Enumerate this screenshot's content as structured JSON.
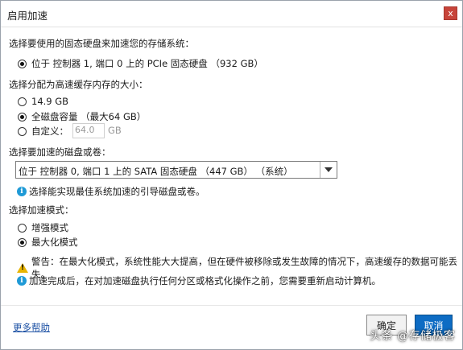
{
  "window": {
    "title": "启用加速",
    "close": "x"
  },
  "sections": {
    "storage_label": "选择要使用的固态硬盘来加速您的存储系统：",
    "storage_option": "位于 控制器 1, 端口 0 上的 PCIe 固态硬盘 （932 GB）",
    "cache_label": "选择分配为高速缓存内存的大小：",
    "cache_options": [
      "14.9 GB",
      "全磁盘容量 （最大64 GB）",
      "自定义："
    ],
    "custom_value": "64.0",
    "custom_unit": "GB",
    "disk_label": "选择要加速的磁盘或卷：",
    "disk_selected": "位于 控制器 0, 端口 1 上的 SATA 固态硬盘 （447 GB） （系统）",
    "disk_hint": "选择能实现最佳系统加速的引导磁盘或卷。",
    "mode_label": "选择加速模式：",
    "mode_options": [
      "增强模式",
      "最大化模式"
    ],
    "warning": "警告：在最大化模式，系统性能大大提高，但在硬件被移除或发生故障的情况下，高速缓存的数据可能丢失。",
    "note": "加速完成后，在对加速磁盘执行任何分区或格式化操作之前，您需要重新启动计算机。"
  },
  "footer": {
    "help": "更多帮助",
    "ok": "确定",
    "cancel": "取消"
  },
  "watermark": "头条 @存储极客",
  "icons": {
    "info": "info-icon",
    "warning": "warning-icon",
    "close": "close-icon",
    "dropdown": "chevron-down-icon"
  },
  "colors": {
    "accent": "#0e6cc4",
    "close": "#c7443a",
    "info": "#1f9ad6",
    "warning": "#e8b400"
  }
}
